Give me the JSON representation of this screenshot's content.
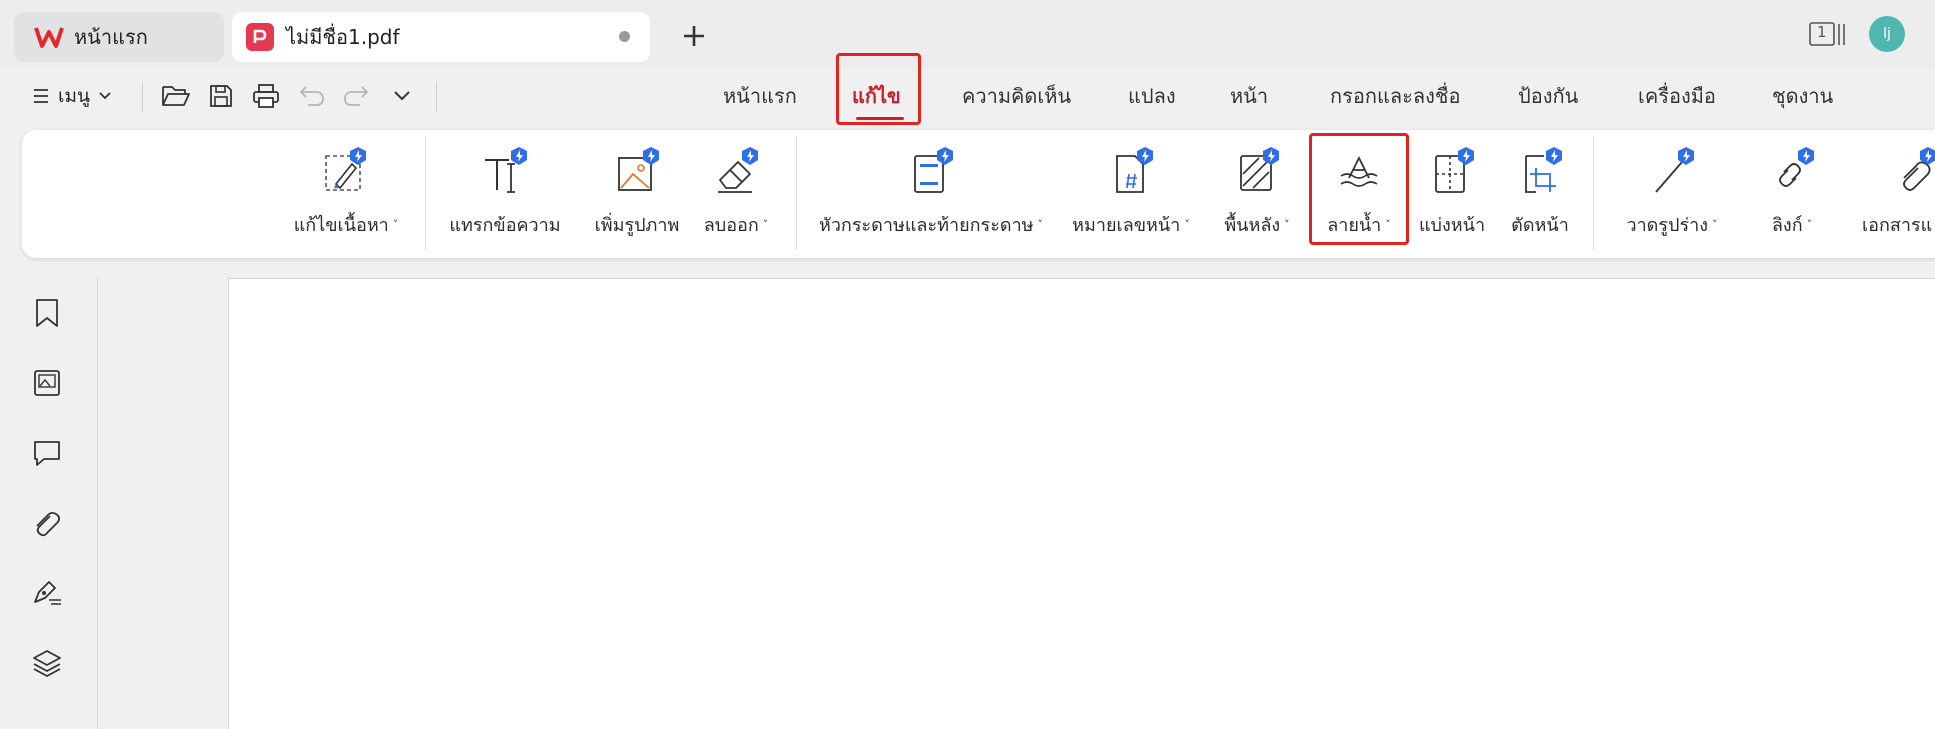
{
  "tabs": {
    "home_label": "หน้าแรก",
    "doc_label": "ไม่มีชื่อ1.pdf"
  },
  "header": {
    "page_count": "1",
    "avatar_initial": "lj"
  },
  "toolbar": {
    "menu_label": "เมนู"
  },
  "main_tabs": [
    {
      "label": "หน้าแรก"
    },
    {
      "label": "แก้ไข"
    },
    {
      "label": "ความคิดเห็น"
    },
    {
      "label": "แปลง"
    },
    {
      "label": "หน้า"
    },
    {
      "label": "กรอกและลงชื่อ"
    },
    {
      "label": "ป้องกัน"
    },
    {
      "label": "เครื่องมือ"
    },
    {
      "label": "ชุดงาน"
    }
  ],
  "ribbon": [
    {
      "label": "แก้ไขเนื้อหา",
      "icon": "edit-content-icon"
    },
    {
      "label": "แทรกข้อความ",
      "icon": "insert-text-icon"
    },
    {
      "label": "เพิ่มรูปภาพ",
      "icon": "add-image-icon"
    },
    {
      "label": "ลบออก",
      "icon": "eraser-icon"
    },
    {
      "label": "หัวกระดาษและท้ายกระดาษ",
      "icon": "header-footer-icon"
    },
    {
      "label": "หมายเลขหน้า",
      "icon": "page-number-icon"
    },
    {
      "label": "พื้นหลัง",
      "icon": "background-icon"
    },
    {
      "label": "ลายน้ำ",
      "icon": "watermark-icon"
    },
    {
      "label": "แบ่งหน้า",
      "icon": "split-page-icon"
    },
    {
      "label": "ตัดหน้า",
      "icon": "crop-page-icon"
    },
    {
      "label": "วาดรูปร่าง",
      "icon": "draw-shape-icon"
    },
    {
      "label": "ลิงก์",
      "icon": "link-icon"
    },
    {
      "label": "เอกสารแ",
      "icon": "attachment-icon"
    }
  ],
  "colors": {
    "accent": "#c8202c",
    "highlight_box": "#e3241c",
    "badge": "#2f6ee8",
    "avatar": "#4fb7b0"
  }
}
